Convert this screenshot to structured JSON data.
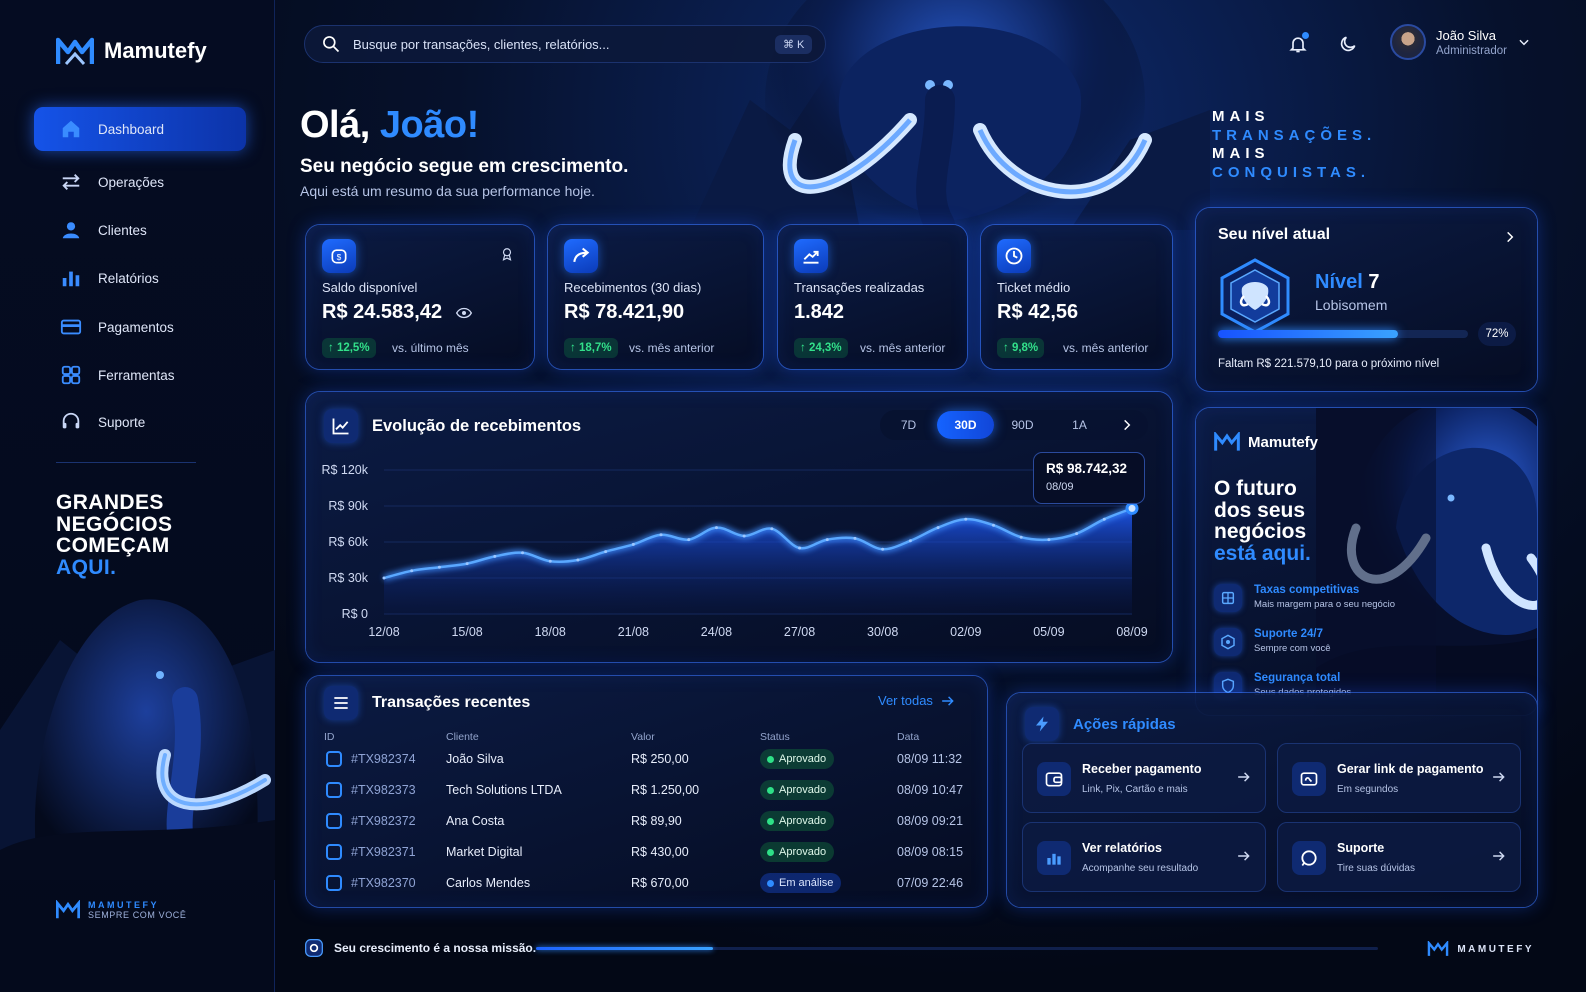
{
  "brand": {
    "name": "Mamutefy",
    "footer_name": "MAMUTEFY",
    "footer_tagline": "SEMPRE COM VOCÊ",
    "bottom_name": "MAMUTEFY"
  },
  "sidebar": {
    "items": [
      {
        "label": "Dashboard",
        "icon": "home-icon"
      },
      {
        "label": "Operações",
        "icon": "transfer-icon"
      },
      {
        "label": "Clientes",
        "icon": "user-icon"
      },
      {
        "label": "Relatórios",
        "icon": "bar-chart-icon"
      },
      {
        "label": "Pagamentos",
        "icon": "card-icon"
      },
      {
        "label": "Ferramentas",
        "icon": "grid-icon"
      },
      {
        "label": "Suporte",
        "icon": "headset-icon"
      }
    ],
    "slogan": [
      "GRANDES",
      "NEGÓCIOS",
      "COMEÇAM",
      "AQUI."
    ]
  },
  "header": {
    "search_placeholder": "Busque por transações, clientes, relatórios...",
    "shortcut": "⌘ K",
    "user_name": "João Silva",
    "user_role": "Administrador"
  },
  "hero": {
    "greet_prefix": "Olá,",
    "greet_name": "João!",
    "subtitle": "Seu negócio segue em crescimento.",
    "subtitle2": "Aqui está um resumo da sua performance hoje.",
    "tagline": [
      "MAIS",
      "TRANSAÇÕES.",
      "MAIS",
      "CONQUISTAS."
    ]
  },
  "stats": [
    {
      "label": "Saldo disponível",
      "value": "R$ 24.583,42",
      "change": "↑ 12,5%",
      "vs": "vs. último mês"
    },
    {
      "label": "Recebimentos (30 dias)",
      "value": "R$ 78.421,90",
      "change": "↑ 18,7%",
      "vs": "vs. mês anterior"
    },
    {
      "label": "Transações realizadas",
      "value": "1.842",
      "change": "↑ 24,3%",
      "vs": "vs. mês anterior"
    },
    {
      "label": "Ticket médio",
      "value": "R$ 42,56",
      "change": "↑ 9,8%",
      "vs": "vs. mês anterior"
    }
  ],
  "level": {
    "title": "Seu nível atual",
    "level_prefix": "Nível",
    "level_number": "7",
    "name": "Lobisomem",
    "progress": 0.72,
    "progress_label": "72%",
    "remaining": "Faltam R$ 221.579,10 para o próximo nível"
  },
  "chart_section": {
    "title": "Evolução de recebimentos",
    "ranges": [
      "7D",
      "30D",
      "90D",
      "1A"
    ],
    "active_range": "30D",
    "tooltip_value": "R$ 98.742,32",
    "tooltip_date": "08/09"
  },
  "chart_data": {
    "type": "area",
    "x": [
      "12/08",
      "13/08",
      "14/08",
      "15/08",
      "16/08",
      "17/08",
      "18/08",
      "19/08",
      "20/08",
      "21/08",
      "22/08",
      "23/08",
      "24/08",
      "25/08",
      "26/08",
      "27/08",
      "28/08",
      "29/08",
      "30/08",
      "31/08",
      "01/09",
      "02/09",
      "03/09",
      "04/09",
      "05/09",
      "06/09",
      "07/09",
      "08/09"
    ],
    "series": [
      {
        "values": [
          30000,
          36000,
          39000,
          42000,
          48000,
          51000,
          44000,
          45000,
          52000,
          58000,
          66000,
          62000,
          72000,
          65000,
          71000,
          55000,
          62000,
          63000,
          54000,
          61000,
          72000,
          79000,
          74000,
          64000,
          62000,
          67000,
          79000,
          88000
        ]
      }
    ],
    "x_ticks": [
      "12/08",
      "15/08",
      "18/08",
      "21/08",
      "24/08",
      "27/08",
      "30/08",
      "02/09",
      "05/09",
      "08/09"
    ],
    "y_ticks": [
      "R$ 0",
      "R$ 30k",
      "R$ 60k",
      "R$ 90k",
      "R$ 120k"
    ],
    "ylim": [
      0,
      120000
    ],
    "grid": true
  },
  "transactions": {
    "title": "Transações recentes",
    "view_all": "Ver todas",
    "columns": [
      "ID",
      "Cliente",
      "Valor",
      "Status",
      "Data"
    ],
    "rows": [
      {
        "id": "#TX982374",
        "client": "João Silva",
        "value": "R$ 250,00",
        "status": "Aprovado",
        "date": "08/09 11:32"
      },
      {
        "id": "#TX982373",
        "client": "Tech Solutions LTDA",
        "value": "R$ 1.250,00",
        "status": "Aprovado",
        "date": "08/09 10:47"
      },
      {
        "id": "#TX982372",
        "client": "Ana Costa",
        "value": "R$ 89,90",
        "status": "Aprovado",
        "date": "08/09 09:21"
      },
      {
        "id": "#TX982371",
        "client": "Market Digital",
        "value": "R$ 430,00",
        "status": "Aprovado",
        "date": "08/09 08:15"
      },
      {
        "id": "#TX982370",
        "client": "Carlos Mendes",
        "value": "R$ 670,00",
        "status": "Em análise",
        "date": "07/09 22:46"
      }
    ]
  },
  "promo": {
    "brand": "Mamutefy",
    "headline": [
      "O futuro",
      "dos seus",
      "negócios",
      "está aqui."
    ],
    "features": [
      {
        "title": "Taxas competitivas",
        "sub": "Mais margem para o seu negócio",
        "icon": "building-icon"
      },
      {
        "title": "Suporte 24/7",
        "sub": "Sempre com você",
        "icon": "support-hex-icon"
      },
      {
        "title": "Segurança total",
        "sub": "Seus dados protegidos",
        "icon": "shield-icon"
      }
    ]
  },
  "quick": {
    "title": "Ações rápidas",
    "items": [
      {
        "title": "Receber pagamento",
        "sub": "Link, Pix, Cartão e mais",
        "icon": "wallet-icon"
      },
      {
        "title": "Gerar link de pagamento",
        "sub": "Em segundos",
        "icon": "link-card-icon"
      },
      {
        "title": "Ver relatórios",
        "sub": "Acompanhe seu resultado",
        "icon": "report-icon"
      },
      {
        "title": "Suporte",
        "sub": "Tire suas dúvidas",
        "icon": "chat-icon"
      }
    ]
  },
  "bottom": {
    "message": "Seu crescimento é a nossa missão.",
    "progress": 0.21
  },
  "colors": {
    "accent": "#2f8bff",
    "positive": "#32e08a",
    "background": "#030816"
  }
}
